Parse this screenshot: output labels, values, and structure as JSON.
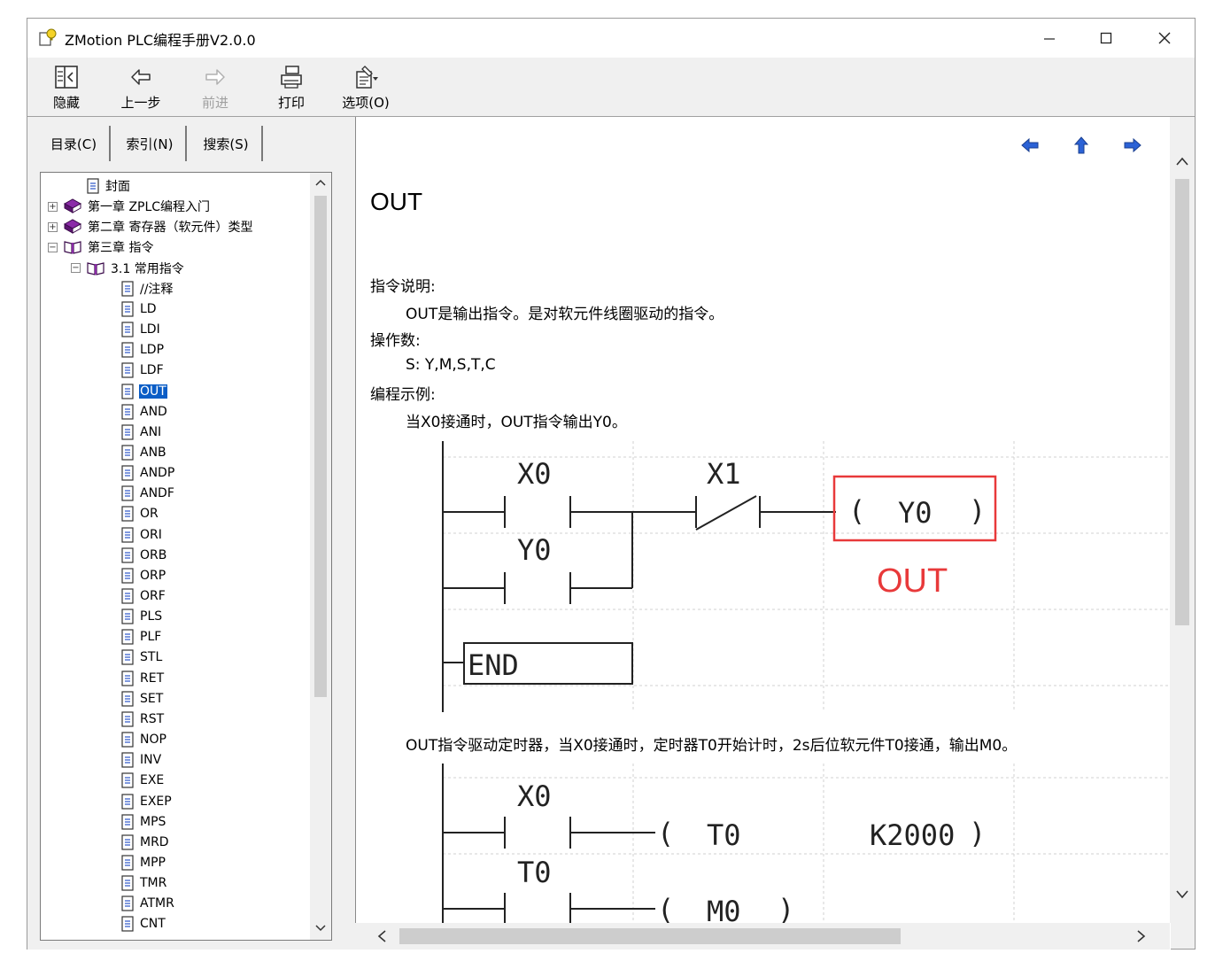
{
  "window": {
    "title": "ZMotion PLC编程手册V2.0.0"
  },
  "toolbar": {
    "items": [
      {
        "label": "隐藏",
        "icon": "hide-icon",
        "enabled": true
      },
      {
        "label": "上一步",
        "icon": "back-arrow-icon",
        "enabled": true
      },
      {
        "label": "前进",
        "icon": "forward-arrow-icon",
        "enabled": false
      },
      {
        "label": "打印",
        "icon": "printer-icon",
        "enabled": true
      },
      {
        "label": "选项(O)",
        "icon": "options-icon",
        "enabled": true
      }
    ]
  },
  "tabs": [
    {
      "label": "目录(C)",
      "active": true
    },
    {
      "label": "索引(N)",
      "active": false
    },
    {
      "label": "搜索(S)",
      "active": false
    }
  ],
  "tree": {
    "items": [
      {
        "label": "封面",
        "level": 1,
        "type": "page"
      },
      {
        "label": "第一章 ZPLC编程入门",
        "level": 0,
        "type": "book-closed",
        "expander": "+"
      },
      {
        "label": "第二章 寄存器（软元件）类型",
        "level": 0,
        "type": "book-closed",
        "expander": "+"
      },
      {
        "label": "第三章 指令",
        "level": 0,
        "type": "book-open",
        "expander": "−"
      },
      {
        "label": "3.1 常用指令",
        "level": 1,
        "type": "book-open",
        "expander": "−"
      },
      {
        "label": "//注释",
        "level": 2,
        "type": "page"
      },
      {
        "label": "LD",
        "level": 2,
        "type": "page"
      },
      {
        "label": "LDI",
        "level": 2,
        "type": "page"
      },
      {
        "label": "LDP",
        "level": 2,
        "type": "page"
      },
      {
        "label": "LDF",
        "level": 2,
        "type": "page"
      },
      {
        "label": "OUT",
        "level": 2,
        "type": "page",
        "selected": true
      },
      {
        "label": "AND",
        "level": 2,
        "type": "page"
      },
      {
        "label": "ANI",
        "level": 2,
        "type": "page"
      },
      {
        "label": "ANB",
        "level": 2,
        "type": "page"
      },
      {
        "label": "ANDP",
        "level": 2,
        "type": "page"
      },
      {
        "label": "ANDF",
        "level": 2,
        "type": "page"
      },
      {
        "label": "OR",
        "level": 2,
        "type": "page"
      },
      {
        "label": "ORI",
        "level": 2,
        "type": "page"
      },
      {
        "label": "ORB",
        "level": 2,
        "type": "page"
      },
      {
        "label": "ORP",
        "level": 2,
        "type": "page"
      },
      {
        "label": "ORF",
        "level": 2,
        "type": "page"
      },
      {
        "label": "PLS",
        "level": 2,
        "type": "page"
      },
      {
        "label": "PLF",
        "level": 2,
        "type": "page"
      },
      {
        "label": "STL",
        "level": 2,
        "type": "page"
      },
      {
        "label": "RET",
        "level": 2,
        "type": "page"
      },
      {
        "label": "SET",
        "level": 2,
        "type": "page"
      },
      {
        "label": "RST",
        "level": 2,
        "type": "page"
      },
      {
        "label": "NOP",
        "level": 2,
        "type": "page"
      },
      {
        "label": "INV",
        "level": 2,
        "type": "page"
      },
      {
        "label": "EXE",
        "level": 2,
        "type": "page"
      },
      {
        "label": "EXEP",
        "level": 2,
        "type": "page"
      },
      {
        "label": "MPS",
        "level": 2,
        "type": "page"
      },
      {
        "label": "MRD",
        "level": 2,
        "type": "page"
      },
      {
        "label": "MPP",
        "level": 2,
        "type": "page"
      },
      {
        "label": "TMR",
        "level": 2,
        "type": "page"
      },
      {
        "label": "ATMR",
        "level": 2,
        "type": "page"
      },
      {
        "label": "CNT",
        "level": 2,
        "type": "page"
      }
    ]
  },
  "content": {
    "heading": "OUT",
    "desc_title": "指令说明:",
    "desc_text": "OUT是输出指令。是对软元件线圈驱动的指令。",
    "operand_title": "操作数:",
    "operand_text": "S: Y,M,S,T,C",
    "example_title": "编程示例:",
    "example1_text": "当X0接通时，OUT指令输出Y0。",
    "example2_text": "OUT指令驱动定时器，当X0接通时，定时器T0开始计时，2s后位软元件T0接通，输出M0。",
    "ladder1": {
      "contact_x0": "X0",
      "contact_x1": "X1",
      "contact_y0": "Y0",
      "coil_open": "(",
      "coil_label": "Y0",
      "coil_close": ")",
      "highlight_label": "OUT",
      "end_label": "END"
    },
    "ladder2": {
      "contact_x0": "X0",
      "contact_t0": "T0",
      "timer_open": "(",
      "timer_label": "T0",
      "timer_value": "K2000",
      "timer_close": ")",
      "coil_open": "(",
      "coil_label": "M0",
      "coil_close": ")"
    }
  },
  "colors": {
    "selection": "#0a5dc6",
    "highlight": "#e8393a",
    "nav_arrow": "#2b62d6"
  }
}
